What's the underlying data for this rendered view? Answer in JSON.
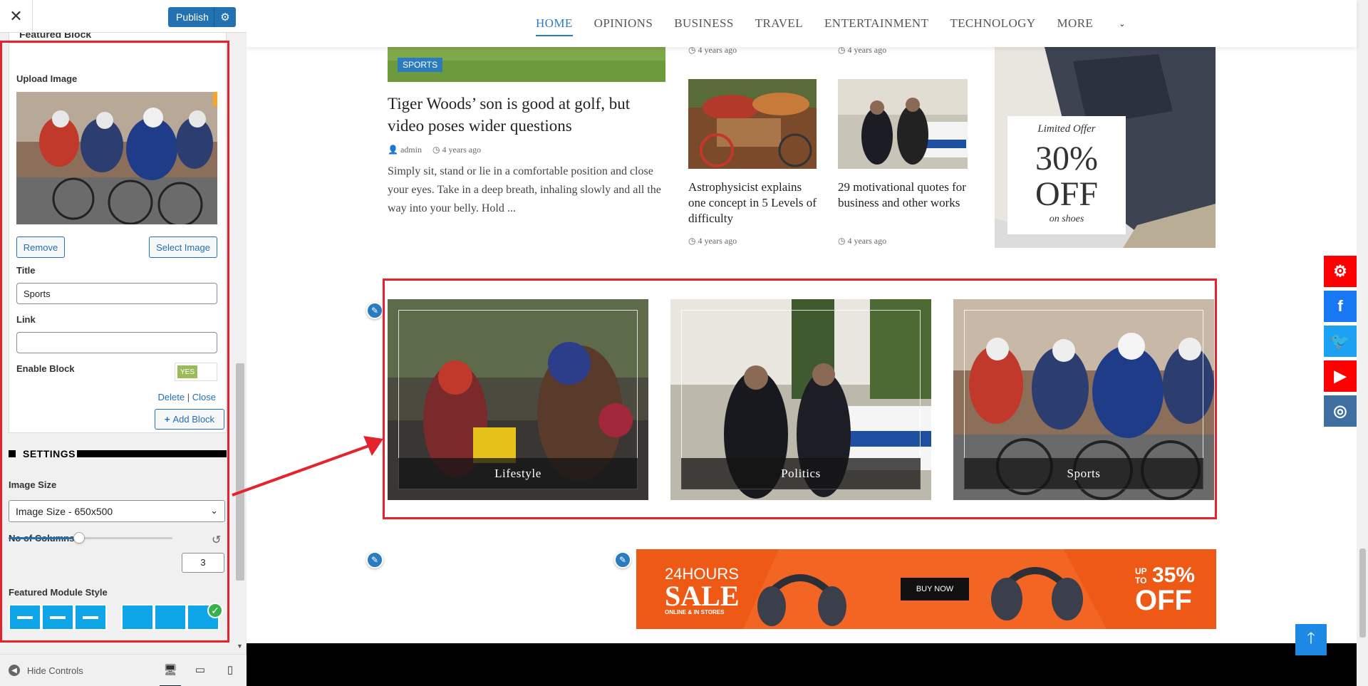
{
  "customizer": {
    "close_icon": "close-icon",
    "publish_label": "Publish",
    "publish_settings_icon": "gear-icon",
    "block_header": "Featured Block",
    "upload_image_label": "Upload Image",
    "remove_label": "Remove",
    "select_image_label": "Select Image",
    "title_label": "Title",
    "title_value": "Sports",
    "link_label": "Link",
    "link_value": "",
    "enable_block_label": "Enable Block",
    "enable_toggle": "YES",
    "delete_label": "Delete",
    "separator": "|",
    "close_label": "Close",
    "add_block_label": "Add Block",
    "settings_heading": "SETTINGS",
    "image_size_label": "Image Size",
    "image_size_value": "Image Size - 650x500",
    "columns_label": "No of Columns",
    "columns_value": "3",
    "columns_slider_fraction": 0.43,
    "module_style_label": "Featured Module Style",
    "hide_controls_label": "Hide Controls"
  },
  "nav": {
    "items": [
      "HOME",
      "OPINIONS",
      "BUSINESS",
      "TRAVEL",
      "ENTERTAINMENT",
      "TECHNOLOGY",
      "MORE"
    ]
  },
  "articles": {
    "main": {
      "tag": "SPORTS",
      "title": "Tiger Woods’ son is good at golf, but video poses wider questions",
      "author": "admin",
      "time": "4 years ago",
      "excerpt": "Simply sit, stand or lie in a comfortable position and close your eyes. Take in a deep breath, inhaling slowly and all the way into your belly. Hold ..."
    },
    "top_times": [
      "4 years ago",
      "4 years ago"
    ],
    "small": [
      {
        "title": "Astrophysicist explains one concept in 5 Levels of difficulty",
        "time": "4 years ago"
      },
      {
        "title": "29 motivational quotes for business and other works",
        "time": "4 years ago"
      }
    ]
  },
  "offer": {
    "line1": "Limited Offer",
    "line2": "30%",
    "line3": "OFF",
    "line4": "on shoes"
  },
  "featured": [
    "Lifestyle",
    "Politics",
    "Sports"
  ],
  "ad": {
    "line1": "24HOURS",
    "line2": "SALE",
    "line3": "ONLINE & IN STORES",
    "buy": "BUY NOW",
    "up": "UP",
    "to": "TO",
    "pct": "35%",
    "off": "OFF"
  },
  "social": [
    {
      "icon": "gear-icon",
      "color": "#ff0000"
    },
    {
      "icon": "facebook-icon",
      "color": "#1877f2"
    },
    {
      "icon": "twitter-icon",
      "color": "#1da1f2"
    },
    {
      "icon": "youtube-icon",
      "color": "#ff0000"
    },
    {
      "icon": "instagram-icon",
      "color": "#3f6ea0"
    }
  ],
  "colors": {
    "accent": "#2b7bbf",
    "wp_blue": "#2271b1",
    "annotation_red": "#e5232d"
  }
}
